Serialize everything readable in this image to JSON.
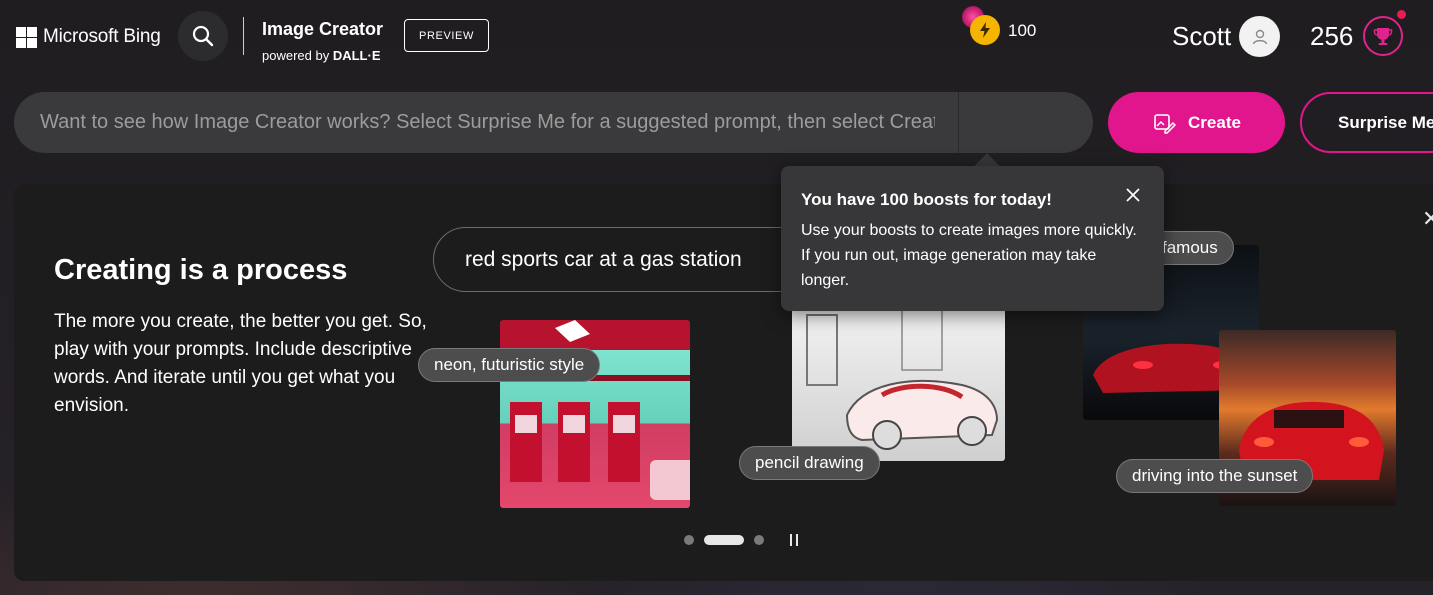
{
  "header": {
    "brand": "Microsoft Bing",
    "app_title": "Image Creator",
    "powered_by_prefix": "powered by ",
    "powered_by_name": "DALL·E",
    "preview_badge": "PREVIEW",
    "user_name": "Scott",
    "reward_points": "256"
  },
  "prompt": {
    "placeholder": "Want to see how Image Creator works? Select Surprise Me for a suggested prompt, then select Create",
    "value": "",
    "boost_count": "100",
    "create_label": "Create",
    "surprise_label": "Surprise Me"
  },
  "tooltip": {
    "title": "You have 100 boosts for today!",
    "text": "Use your boosts to create images more quickly. If you run out, image generation may take longer."
  },
  "card": {
    "title": "Creating is a process",
    "body": "The more you create, the better you get. So, play with your prompts. Include descriptive words. And iterate until you get what you envision.",
    "example_prompt": "red sports car at a gas station",
    "tags": [
      "neon, futuristic style",
      "pencil drawing",
      "driving into the sunset",
      "famous"
    ],
    "carousel_pages": 3,
    "carousel_active_page": 2
  },
  "colors": {
    "accent": "#e1168d",
    "background": "#1d1b1e",
    "card": "#1c1c1c",
    "boost": "#f5b400"
  },
  "icons": {
    "search": "search-icon",
    "avatar": "user-icon",
    "rewards": "trophy-icon",
    "boost": "lightning-icon",
    "create": "image-edit-icon",
    "close": "close-icon",
    "pause": "pause-icon"
  }
}
